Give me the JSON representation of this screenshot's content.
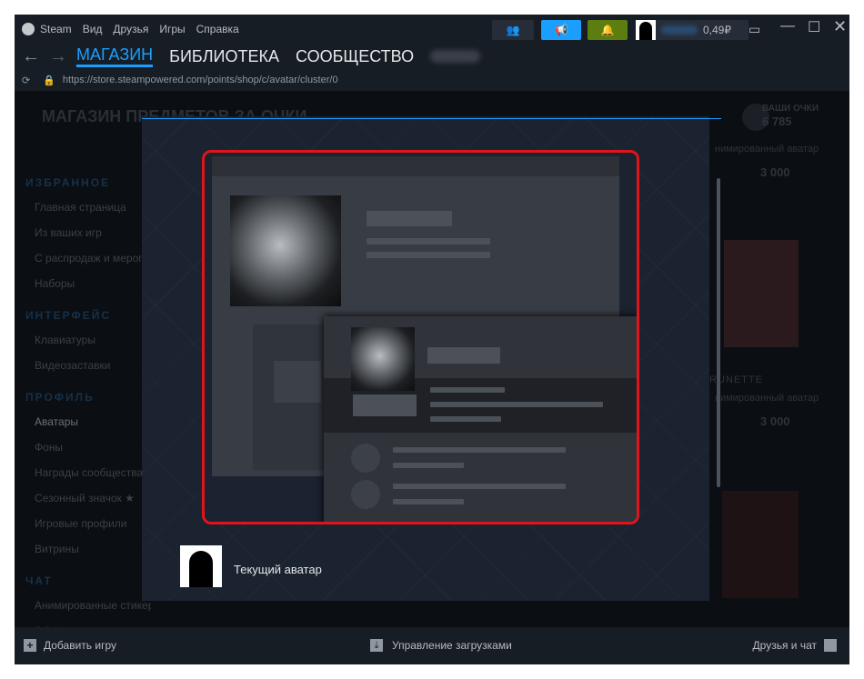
{
  "menu": {
    "app": "Steam",
    "items": [
      "Вид",
      "Друзья",
      "Игры",
      "Справка"
    ]
  },
  "topbar": {
    "wallet": "0,49₽",
    "icons": [
      "friends-icon",
      "megaphone-icon",
      "bell-icon",
      "monitor-icon",
      "minimize-icon",
      "maximize-icon",
      "close-icon"
    ],
    "announce_color": "#1a9fff",
    "notify_color": "#5c7e10"
  },
  "nav": {
    "tabs": [
      "МАГАЗИН",
      "БИБЛИОТЕКА",
      "СООБЩЕСТВО"
    ],
    "active": 0
  },
  "url": "https://store.steampowered.com/points/shop/c/avatar/cluster/0",
  "page": {
    "title": "МАГАЗИН ПРЕДМЕТОВ ЗА ОЧКИ",
    "points_label": "ВАШИ ОЧКИ",
    "points": "6 785",
    "cards": [
      {
        "name": "",
        "type": "нимированный аватар",
        "price": "3 000"
      },
      {
        "name": "RUNETTE",
        "type": "нимированный аватар",
        "price": "3 000"
      }
    ]
  },
  "sidebar": [
    {
      "heading": "ИЗБРАННОЕ",
      "items": [
        "Главная страница",
        "Из ваших игр",
        "С распродаж и меропр",
        "Наборы"
      ]
    },
    {
      "heading": "ИНТЕРФЕЙС",
      "items": [
        "Клавиатуры",
        "Видеозаставки"
      ]
    },
    {
      "heading": "ПРОФИЛЬ",
      "items": [
        "Аватары",
        "Фоны",
        "Награды сообщества",
        "Сезонный значок ★",
        "Игровые профили",
        "Витрины"
      ]
    },
    {
      "heading": "ЧАТ",
      "items": [
        "Анимированные стикер",
        "Эффекты для чата"
      ]
    }
  ],
  "modal": {
    "current_avatar_label": "Текущий аватар"
  },
  "footer": {
    "add_game": "Добавить игру",
    "downloads": "Управление загрузками",
    "friends": "Друзья и чат"
  }
}
